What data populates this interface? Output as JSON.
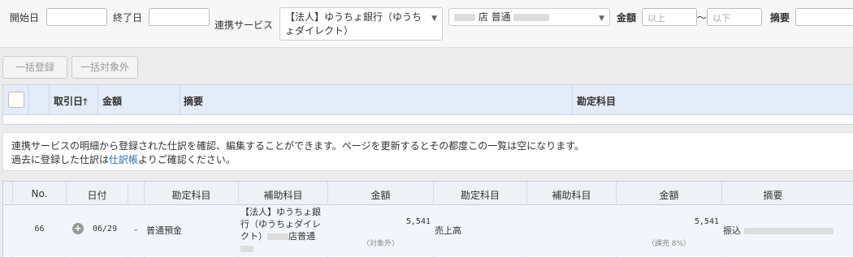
{
  "filters": {
    "start_date_label": "開始日",
    "end_date_label": "終了日",
    "service_label": "連携サービス",
    "service_value": "【法人】ゆうちょ銀行（ゆうちょダイレクト）",
    "account_value": "店 普通",
    "amount_label": "金額",
    "amount_min_placeholder": "以上",
    "tilde": "〜",
    "amount_max_placeholder": "以下",
    "memo_label": "摘要"
  },
  "actions": {
    "bulk_register": "一括登録",
    "bulk_exclude": "一括対象外"
  },
  "list_table": {
    "headers": {
      "date": "取引日",
      "sort_arrow": "🡑",
      "amount": "金額",
      "memo": "摘要",
      "account": "勘定科目"
    }
  },
  "info": {
    "line1": "連携サービスの明細から登録された仕訳を確認、編集することができます。ページを更新するとその都度この一覧は空になります。",
    "line2_pre": "過去に登録した仕訳は",
    "line2_link": "仕訳帳",
    "line2_post": "よりご確認ください。"
  },
  "journal_table": {
    "headers": {
      "no": "No.",
      "date": "日付",
      "debit_account": "勘定科目",
      "debit_sub": "補助科目",
      "debit_amount": "金額",
      "credit_account": "勘定科目",
      "credit_sub": "補助科目",
      "credit_amount": "金額",
      "memo": "摘要"
    },
    "rows": [
      {
        "no": "66",
        "date": "06/29",
        "debit_account": "普通預金",
        "debit_sub_l1": "【法人】ゆうちょ銀",
        "debit_sub_l2": "行（ゆうちょダイレ",
        "debit_sub_l3a": "クト）",
        "debit_sub_l3b": "店普通",
        "debit_amount": "5,541",
        "debit_tax": "（対象外）",
        "credit_account": "売上高",
        "credit_sub": "",
        "credit_amount": "5,541",
        "credit_tax": "（課売 8%）",
        "memo": "振込"
      }
    ]
  },
  "icons": {
    "select_caret": "caret-down-icon",
    "sort": "arrow-up-icon",
    "expand": "plus-circle-icon",
    "row_toggle": "chevron-down-icon"
  },
  "colors": {
    "header_bg": "#e4ecf7",
    "row_bg": "#f2f5fb",
    "link": "#2a6bb0"
  }
}
